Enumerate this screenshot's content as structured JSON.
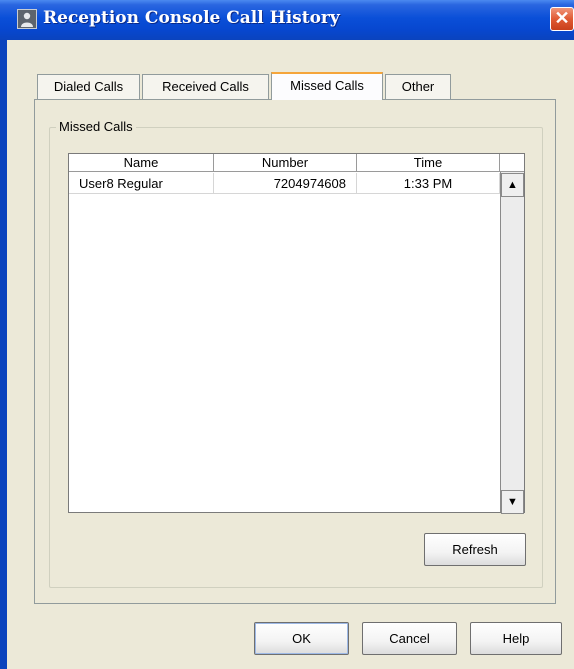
{
  "window": {
    "title": "Reception Console Call History",
    "close_glyph": "✕",
    "colors": {
      "titlebar": "#0a4fd8",
      "face": "#ece9d8",
      "active_tab_accent": "#f5a53a"
    }
  },
  "tabs": [
    {
      "label": "Dialed Calls",
      "active": false
    },
    {
      "label": "Received Calls",
      "active": false
    },
    {
      "label": "Missed Calls",
      "active": true
    },
    {
      "label": "Other",
      "active": false
    }
  ],
  "group": {
    "label": "Missed Calls"
  },
  "table": {
    "columns": [
      "Name",
      "Number",
      "Time"
    ],
    "rows": [
      {
        "name": "User8 Regular",
        "number": "7204974608",
        "time": "1:33 PM"
      }
    ],
    "scroll_up_glyph": "▲",
    "scroll_down_glyph": "▼"
  },
  "buttons": {
    "refresh": "Refresh",
    "ok": "OK",
    "cancel": "Cancel",
    "help": "Help"
  },
  "icons": {
    "app": "person-icon",
    "close": "close-icon",
    "scroll_up": "arrow-up-icon",
    "scroll_down": "arrow-down-icon"
  }
}
